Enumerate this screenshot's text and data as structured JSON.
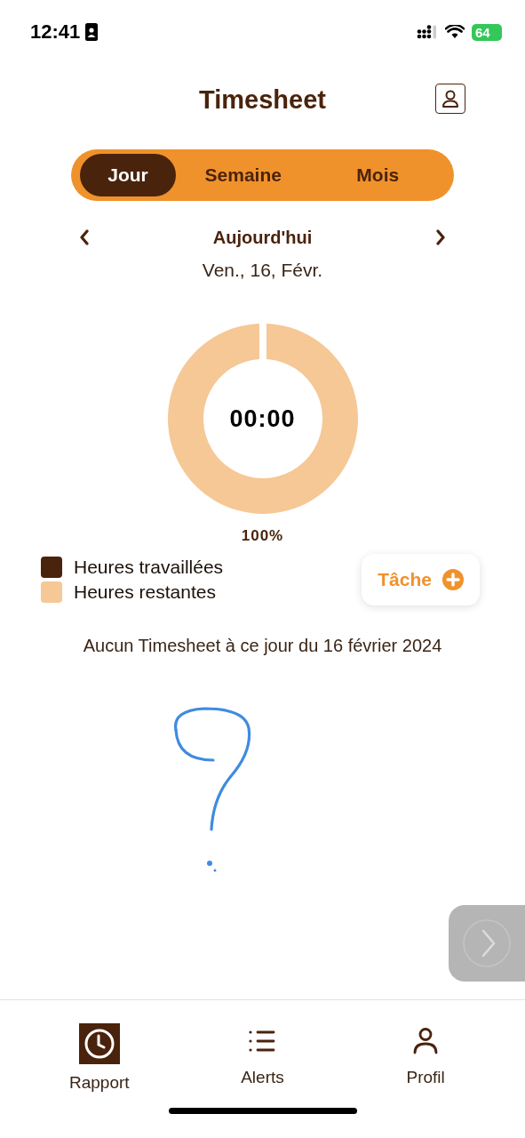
{
  "status_bar": {
    "time": "12:41",
    "battery": "64"
  },
  "header": {
    "title": "Timesheet"
  },
  "tabs": [
    {
      "label": "Jour",
      "selected": true
    },
    {
      "label": "Semaine",
      "selected": false
    },
    {
      "label": "Mois",
      "selected": false
    }
  ],
  "date_nav": {
    "title": "Aujourd'hui",
    "date": "Ven., 16, Févr."
  },
  "summary": {
    "time": "00:00",
    "percent": "100%"
  },
  "legend": [
    {
      "label": "Heures travaillées",
      "color": "#4a230c"
    },
    {
      "label": "Heures restantes",
      "color": "#f5c896"
    }
  ],
  "task_button": {
    "label": "Tâche"
  },
  "empty_message": "Aucun Timesheet à ce jour du 16 février 2024",
  "bottom_nav": [
    {
      "label": "Rapport",
      "kind": "clock",
      "selected": true
    },
    {
      "label": "Alerts",
      "kind": "list",
      "selected": false
    },
    {
      "label": "Profil",
      "kind": "person",
      "selected": false
    }
  ]
}
